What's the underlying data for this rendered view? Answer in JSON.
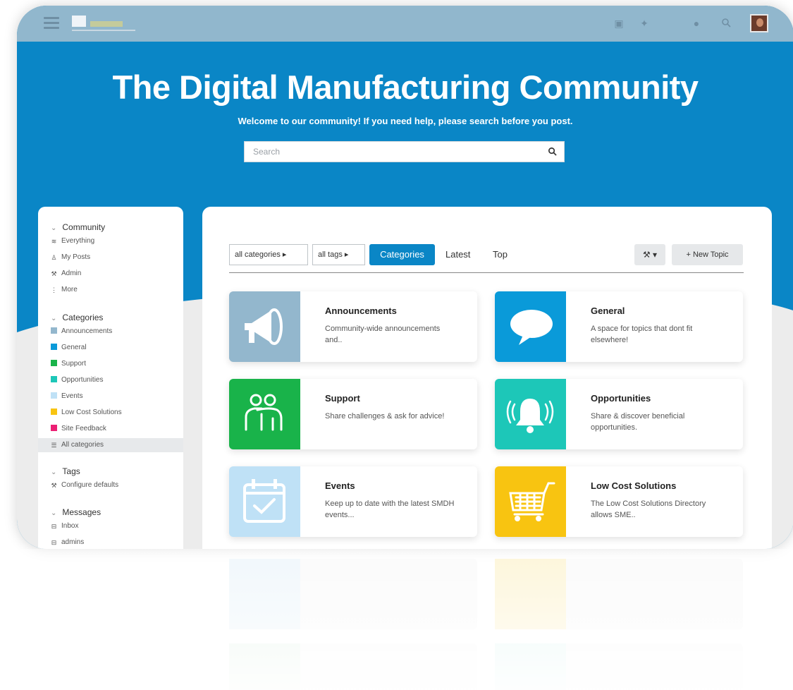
{
  "topbar": {
    "icons": [
      "menu-icon",
      "logo",
      "github-icon",
      "twitter-icon",
      "chat-icon",
      "search-icon",
      "avatar"
    ]
  },
  "hero": {
    "title": "The Digital Manufacturing Community",
    "subtitle": "Welcome to our community! If you need help, please search before you post.",
    "search_placeholder": "Search"
  },
  "sidebar": {
    "sections": [
      {
        "label": "Community",
        "items": [
          {
            "label": "Everything",
            "icon": "layers-icon"
          },
          {
            "label": "My Posts",
            "icon": "user-icon"
          },
          {
            "label": "Admin",
            "icon": "wrench-icon"
          },
          {
            "label": "More",
            "icon": "more-vertical-icon"
          }
        ]
      },
      {
        "label": "Categories",
        "items": [
          {
            "label": "Announcements",
            "color": "#93b7cd"
          },
          {
            "label": "General",
            "color": "#0a9ad9"
          },
          {
            "label": "Support",
            "color": "#19b34a"
          },
          {
            "label": "Opportunities",
            "color": "#1dc7b8"
          },
          {
            "label": "Events",
            "color": "#bfe1f6"
          },
          {
            "label": "Low Cost Solutions",
            "color": "#f8c411"
          },
          {
            "label": "Site Feedback",
            "color": "#ec1f74"
          },
          {
            "label": "All categories",
            "icon": "list-icon",
            "active": true
          }
        ]
      },
      {
        "label": "Tags",
        "items": [
          {
            "label": "Configure defaults",
            "icon": "wrench-icon"
          }
        ]
      },
      {
        "label": "Messages",
        "items": [
          {
            "label": "Inbox",
            "icon": "inbox-icon"
          },
          {
            "label": "admins",
            "icon": "inbox-icon"
          }
        ]
      }
    ]
  },
  "nav": {
    "categories_dropdown": "all categories",
    "tags_dropdown": "all tags",
    "active_tab": "Categories",
    "latest": "Latest",
    "top": "Top",
    "new_topic": "+ New Topic",
    "wrench": "⚒ ▾"
  },
  "categories": [
    {
      "title": "Announcements",
      "description": "Community-wide announcements and..",
      "color": "#93b7cd",
      "icon": "megaphone-icon"
    },
    {
      "title": "General",
      "description": "A space for topics that dont fit elsewhere!",
      "color": "#0a9ad9",
      "icon": "speech-bubble-icon"
    },
    {
      "title": "Support",
      "description": "Share challenges & ask for advice!",
      "color": "#19b34a",
      "icon": "people-support-icon"
    },
    {
      "title": "Opportunities",
      "description": "Share & discover beneficial opportunities.",
      "color": "#1dc7b8",
      "icon": "bell-icon"
    },
    {
      "title": "Events",
      "description": "Keep up to date with the latest SMDH events...",
      "color": "#bfe1f6",
      "icon": "calendar-check-icon"
    },
    {
      "title": "Low Cost Solutions",
      "description": "The Low Cost Solutions Directory allows SME..",
      "color": "#f8c411",
      "icon": "shopping-cart-icon"
    }
  ],
  "colors": {
    "brand_blue": "#0a86c6",
    "topbar": "#91b7cd"
  }
}
